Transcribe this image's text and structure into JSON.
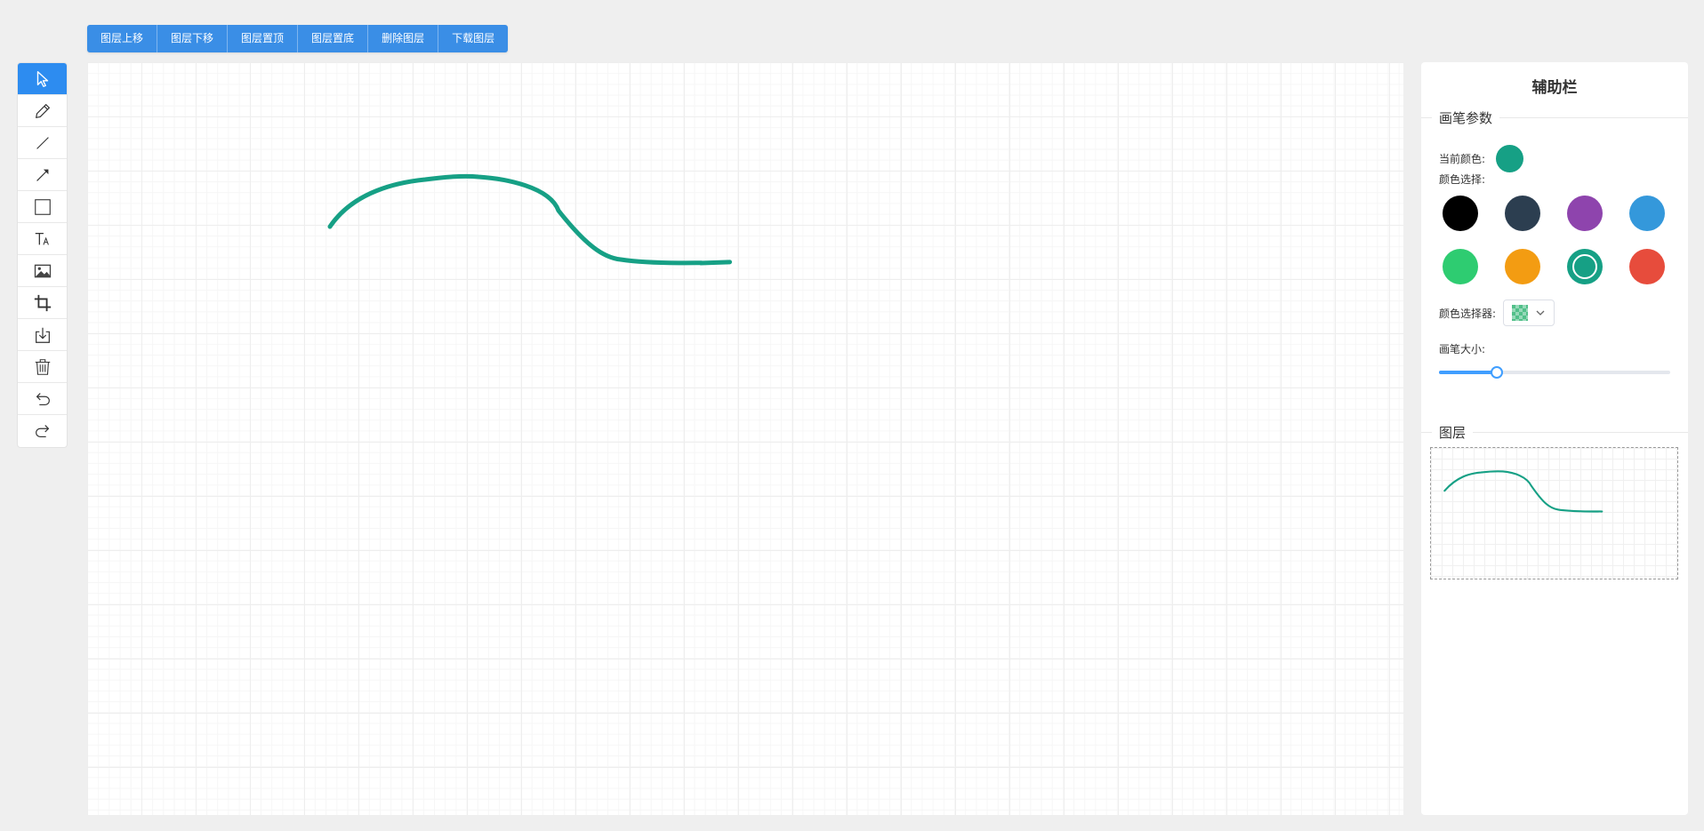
{
  "layer_toolbar": {
    "buttons": [
      "图层上移",
      "图层下移",
      "图层置顶",
      "图层置底",
      "删除图层",
      "下载图层"
    ]
  },
  "tools": [
    {
      "name": "select-tool",
      "icon": "cursor-icon",
      "active": true
    },
    {
      "name": "pencil-tool",
      "icon": "pencil-icon"
    },
    {
      "name": "line-tool",
      "icon": "line-icon"
    },
    {
      "name": "arrow-tool",
      "icon": "arrow-icon"
    },
    {
      "name": "rectangle-tool",
      "icon": "rectangle-icon"
    },
    {
      "name": "text-tool",
      "icon": "text-icon"
    },
    {
      "name": "image-tool",
      "icon": "image-icon"
    },
    {
      "name": "crop-tool",
      "icon": "crop-icon"
    },
    {
      "name": "download-tool",
      "icon": "download-icon"
    },
    {
      "name": "delete-tool",
      "icon": "trash-icon"
    },
    {
      "name": "undo-tool",
      "icon": "undo-icon"
    },
    {
      "name": "redo-tool",
      "icon": "redo-icon"
    }
  ],
  "stroke_color": "#16a085",
  "panel": {
    "title": "辅助栏",
    "brush_section": "画笔参数",
    "current_color_label": "当前颜色:",
    "current_color": "#16a085",
    "color_select_label": "颜色选择:",
    "swatches": [
      "#000000",
      "#2c3e50",
      "#8e44ad",
      "#3498db",
      "#2ecc71",
      "#f39c12",
      "#16a085",
      "#e74c3c"
    ],
    "selected_swatch": 6,
    "picker_label": "颜色选择器:",
    "picker_color": "#52c08a",
    "size_label": "画笔大小:",
    "brush_size_fraction": 0.25,
    "layers_section": "图层"
  }
}
